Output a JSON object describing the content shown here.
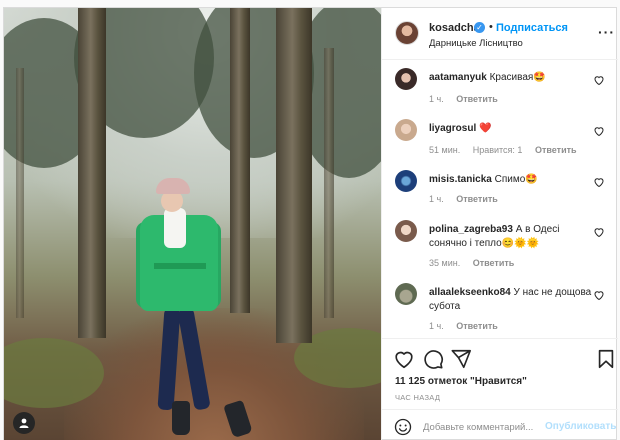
{
  "post": {
    "username": "kosadcha",
    "follow_label": "Подписаться",
    "separator": "•",
    "location": "Дарницьке Лісництво",
    "more_icon": "more-horizontal-icon",
    "verified_icon": "verified-badge-icon",
    "verified_glyph": "✓"
  },
  "comments": [
    {
      "username": "aatamanyuk",
      "text": "Красивая🤩",
      "time": "1 ч.",
      "likes": "",
      "reply": "Ответить"
    },
    {
      "username": "liyagrosul",
      "text": "❤️",
      "time": "51 мин.",
      "likes": "Нравится: 1",
      "reply": "Ответить"
    },
    {
      "username": "misis.tanicka",
      "text": "Спимо🤩",
      "time": "1 ч.",
      "likes": "",
      "reply": "Ответить"
    },
    {
      "username": "polina_zagreba93",
      "text": "А в Одесі сонячно і тепло😊🌞🌞",
      "time": "35 мин.",
      "likes": "",
      "reply": "Ответить"
    },
    {
      "username": "allaalekseenko84",
      "text": "У нас не дощова субота",
      "time": "1 ч.",
      "likes": "",
      "reply": "Ответить"
    }
  ],
  "actions": {
    "likes_count": "11 125 отметок \"Нравится\"",
    "time_ago": "ЧАС НАЗАД",
    "comment_placeholder": "Добавьте комментарий...",
    "publish_label": "Опубликовать"
  },
  "colors": {
    "accent": "#0095f6",
    "verified": "#3897f0",
    "publish_disabled": "#b2dffc",
    "jacket": "#2db96d",
    "heart": "#ed4956"
  }
}
